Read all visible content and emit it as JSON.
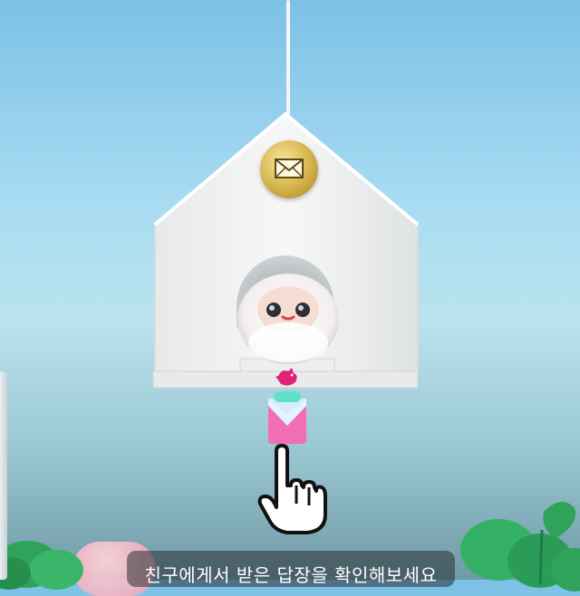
{
  "caption": {
    "text": "친구에게서 받은 답장을 확인해보세요"
  },
  "icons": {
    "mail": "envelope-icon",
    "bird": "bird-icon",
    "hand": "pointing-hand-icon",
    "letter": "letter-envelope-icon"
  },
  "colors": {
    "sky_top": "#7cc1e6",
    "house": "#f2f3f4",
    "gold": "#d4b24a",
    "letter_pink": "#f06fb6",
    "letter_mint": "#5fe0c8",
    "bird_magenta": "#e0237a",
    "clover_green": "#2fa35a"
  }
}
